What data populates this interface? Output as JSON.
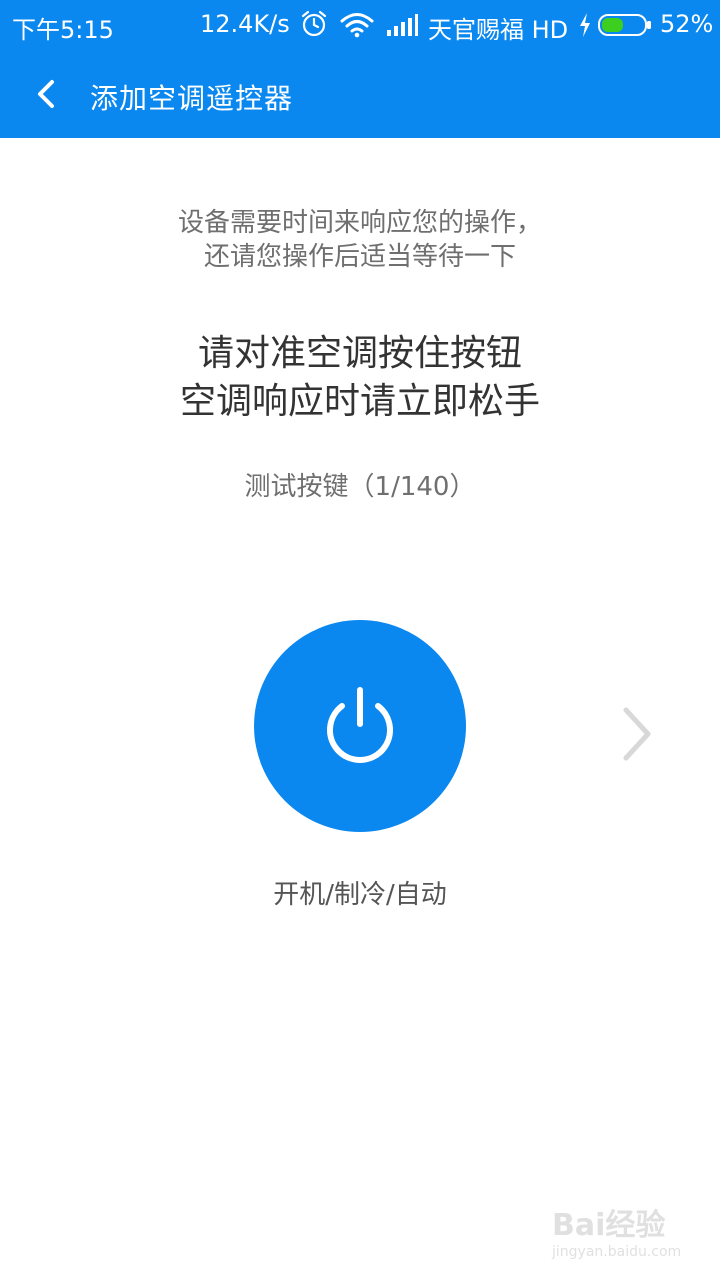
{
  "status_bar": {
    "time": "下午5:15",
    "network_speed": "12.4K/s",
    "carrier": "天官赐福 HD",
    "battery_percent": "52%",
    "battery_level": 0.52,
    "icons": [
      "alarm-icon",
      "wifi-icon",
      "signal-icon",
      "charging-icon",
      "battery-icon"
    ]
  },
  "header": {
    "title": "添加空调遥控器",
    "back_icon": "chevron-left-icon"
  },
  "main": {
    "hint_line1": "设备需要时间来响应您的操作，",
    "hint_line2": "还请您操作后适当等待一下",
    "instruction_line1": "请对准空调按住按钮",
    "instruction_line2": "空调响应时请立即松手",
    "test_key": "测试按键（1/140）",
    "power_button_icon": "power-icon",
    "next_icon": "chevron-right-icon",
    "mode_label": "开机/制冷/自动"
  },
  "watermark": {
    "logo_text": "Bai经验",
    "sub_text": "jingyan.baidu.com"
  },
  "colors": {
    "primary": "#0a88ef",
    "battery_fill": "#3ccf1f",
    "text_dark": "#333333",
    "text_muted": "#6f6f6f",
    "chevron_gray": "#d8d8d8"
  }
}
